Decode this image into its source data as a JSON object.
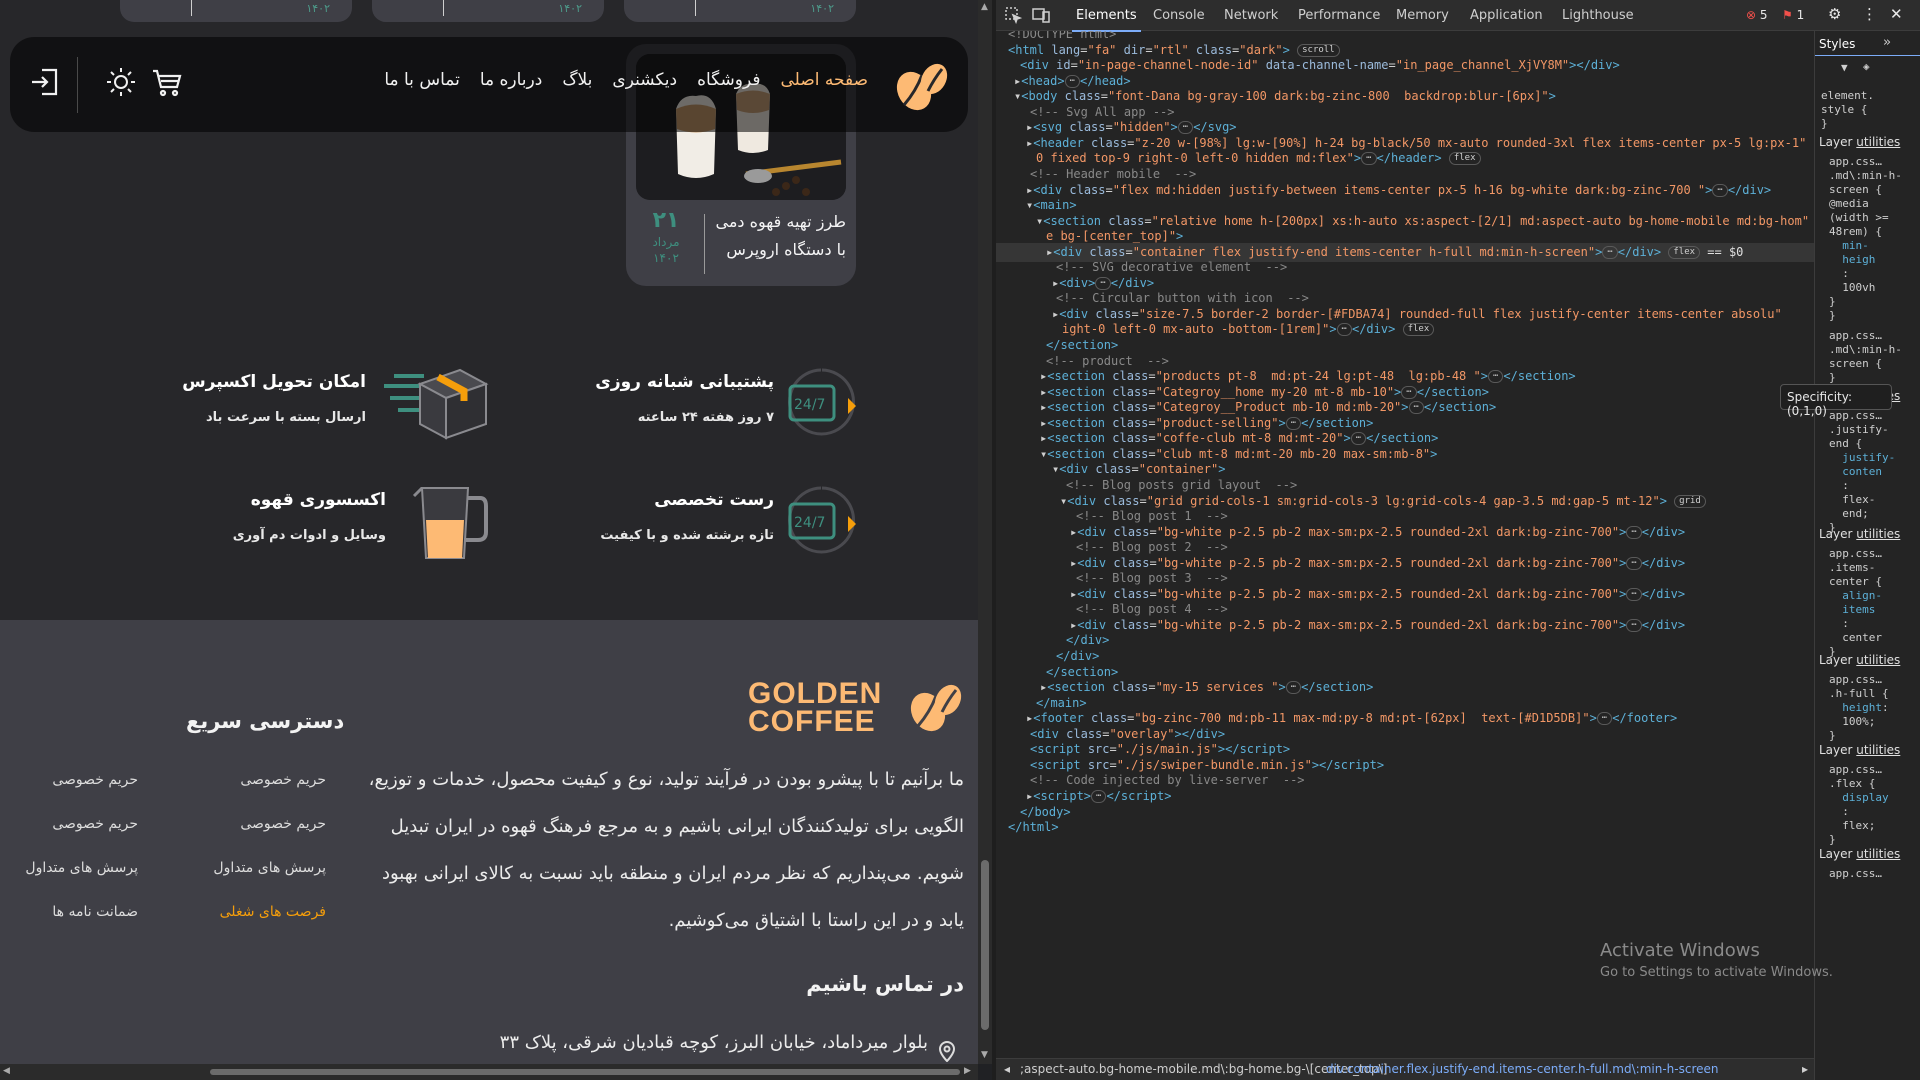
{
  "site": {
    "top_cards": [
      "۱۴۰۲",
      "۱۴۰۲",
      "۱۴۰۲"
    ],
    "nav": [
      "صفحه اصلی",
      "فروشگاه",
      "دیکشنری",
      "بلاگ",
      "درباره ما",
      "تماس با ما"
    ],
    "blog_card": {
      "title": "طرز تهیه قهوه دمی با دستگاه اروپرس",
      "day": "۲۱",
      "month": "مرداد",
      "year": "۱۴۰۲"
    },
    "services": [
      {
        "title": "امکان تحویل اکسپرس",
        "desc": "ارسال بسته با سرعت باد",
        "icon": "delivery-box-icon"
      },
      {
        "title": "پشتیبانی شبانه روزی",
        "desc": "۷ روز هفته ۲۴ ساعته",
        "icon": "support-24-7-icon"
      },
      {
        "title": "اکسسوری قهوه",
        "desc": "وسایل و ادوات دم آوری",
        "icon": "coffee-pitcher-icon"
      },
      {
        "title": "رست تخصصی",
        "desc": "تازه برشته شده و با کیفیت",
        "icon": "roast-24-7-icon"
      }
    ],
    "footer": {
      "logo_line1": "GOLDEN",
      "logo_line2": "COFFEE",
      "about": "ما برآنیم تا با پیشرو بودن در فرآیند تولید، نوع و کیفیت محصول، خدمات و توزیع، الگویی برای تولیدکنندگان ایرانی باشیم و به مرجع فرهنگ قهوه در ایران تبدیل شویم. می‌پنداریم که نظر مردم ایران و منطقه باید نسبت به کالای ایرانی بهبود یابد و در این راستا با اشتیاق می‌کوشیم.",
      "quick_title": "دسترسی سریع",
      "quick_links_col1": [
        "حریم خصوصی",
        "حریم خصوصی",
        "پرسش های متداول",
        "فرصت های شغلی"
      ],
      "quick_links_col2": [
        "حریم خصوصی",
        "حریم خصوصی",
        "پرسش های متداول",
        "ضمانت نامه ها"
      ],
      "contact_title": "در تماس باشیم",
      "address": "بلوار میرداماد، خیابان البرز، کوچه قبادیان شرقی، پلاک ۳۳"
    },
    "accent": "#fdba74",
    "teal": "#3e8f7f"
  },
  "devtools": {
    "tabs": [
      "Elements",
      "Console",
      "Network",
      "Performance",
      "Memory",
      "Application",
      "Lighthouse"
    ],
    "errors": "5",
    "warnings": "1",
    "styles_tab": "Styles",
    "tooltip": "Specificity: (0,1,0)",
    "breadcrumb_1": ";aspect-auto.bg-home-mobile.md\\:bg-home.bg-\\[center_top\\]",
    "breadcrumb_2": "div.container.flex.justify-end.items-center.h-full.md\\:min-h-screen",
    "activate_title": "Activate Windows",
    "activate_sub": "Go to Settings to activate Windows.",
    "layer_label": "Layer",
    "layer_link": "utilities"
  }
}
